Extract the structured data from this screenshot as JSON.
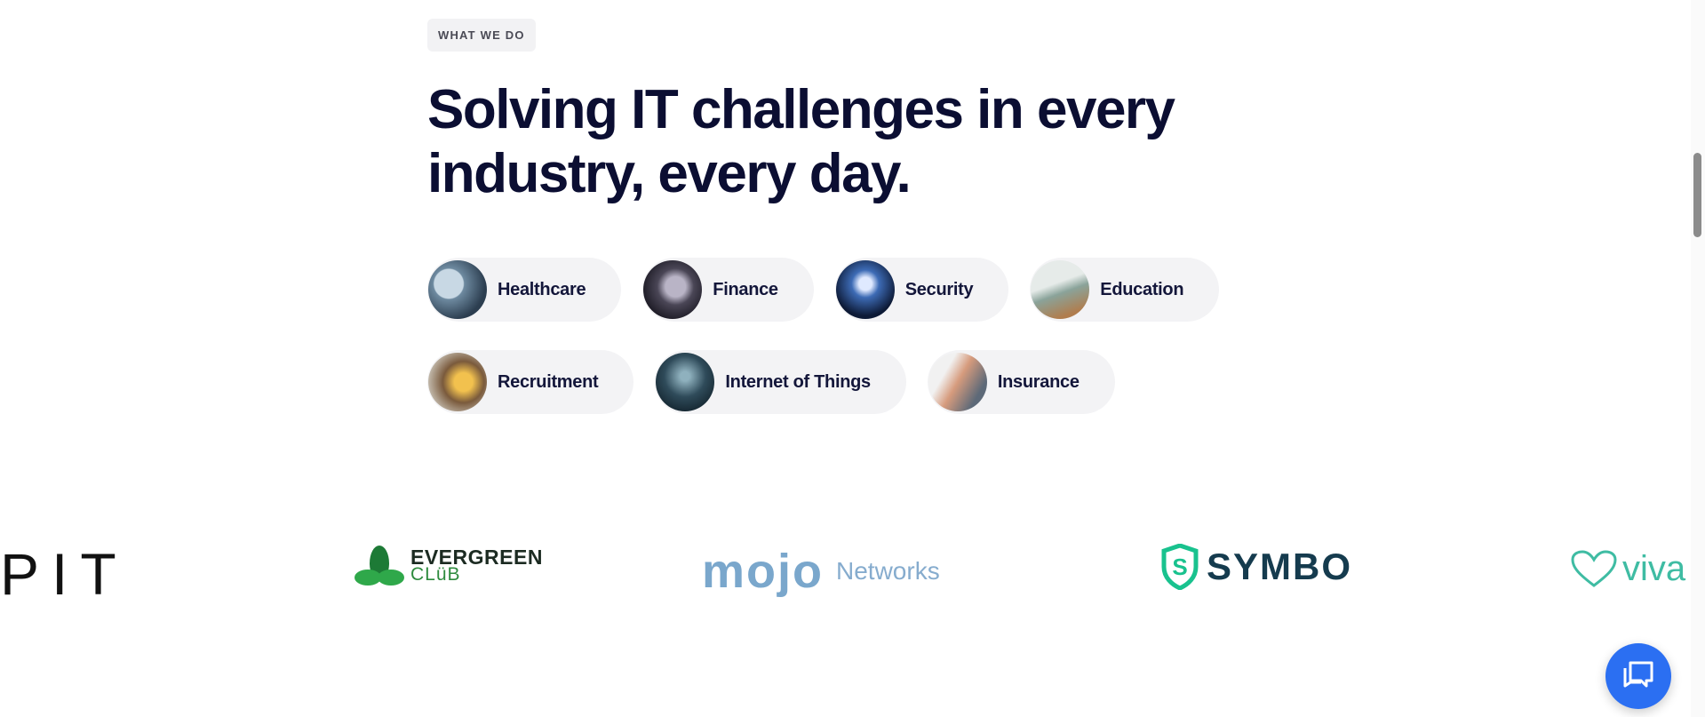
{
  "section": {
    "eyebrow": "WHAT WE DO",
    "headline": "Solving IT challenges in every industry, every day."
  },
  "industries": {
    "row1": [
      {
        "label": "Healthcare"
      },
      {
        "label": "Finance"
      },
      {
        "label": "Security"
      },
      {
        "label": "Education"
      }
    ],
    "row2": [
      {
        "label": "Recruitment"
      },
      {
        "label": "Internet of Things"
      },
      {
        "label": "Insurance"
      }
    ]
  },
  "logos": {
    "pit": "PIT",
    "evergreen_top": "EVERGREEN",
    "evergreen_bottom": "CLüB",
    "mojo": "mojo",
    "mojo_sub": "Networks",
    "symbo": "SYMBO",
    "viva": "viva"
  },
  "colors": {
    "headline": "#0b0e32",
    "pill_bg": "#f3f3f5",
    "chat_button": "#2b6ff2",
    "evergreen": "#2e8b3e",
    "mojo": "#7aa7cc",
    "symbo": "#153b4e",
    "viva": "#3fbca3"
  },
  "icons": {
    "chat": "chat-bubble-icon"
  }
}
